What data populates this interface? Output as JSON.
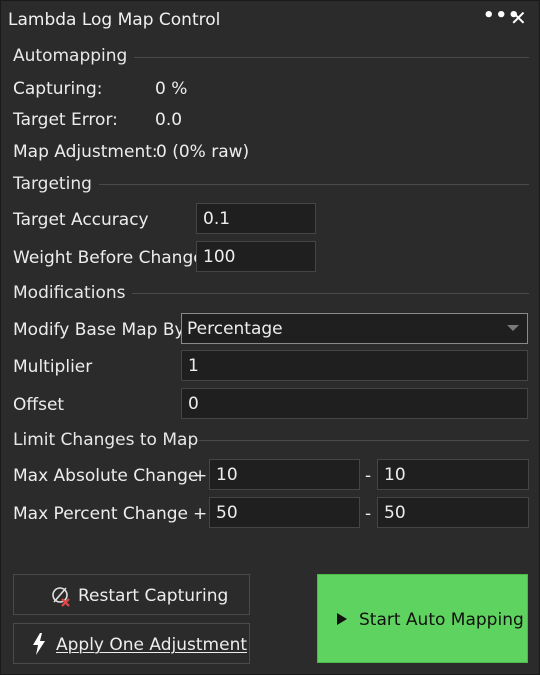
{
  "window": {
    "title": "Lambda Log Map Control",
    "more_icon": "more-horizontal-icon",
    "close_icon": "close-icon"
  },
  "automapping": {
    "header": "Automapping",
    "capturing_label": "Capturing:",
    "capturing_value": "0 %",
    "target_error_label": "Target Error:",
    "target_error_value": "0.0",
    "map_adjustment_label": "Map Adjustment:",
    "map_adjustment_value": "0 (0% raw)"
  },
  "targeting": {
    "header": "Targeting",
    "target_accuracy_label": "Target Accuracy",
    "target_accuracy_value": "0.1",
    "weight_label": "Weight Before Change",
    "weight_value": "100"
  },
  "modifications": {
    "header": "Modifications",
    "modify_label": "Modify Base Map By",
    "modify_value": "Percentage",
    "multiplier_label": "Multiplier",
    "multiplier_value": "1",
    "offset_label": "Offset",
    "offset_value": "0"
  },
  "limits": {
    "header": "Limit Changes to Map",
    "max_abs_label": "Max Absolute Change",
    "plus": "+",
    "minus": "-",
    "max_abs_plus": "10",
    "max_abs_minus": "10",
    "max_pct_label": "Max Percent Change",
    "max_pct_plus": "50",
    "max_pct_minus": "50"
  },
  "actions": {
    "restart_label": "Restart Capturing",
    "restart_icon": "restart-capture-icon",
    "apply_label": "Apply One Adjustment",
    "apply_icon": "lightning-icon",
    "start_label": "Start Auto Mapping",
    "start_icon": "play-icon",
    "start_color": "#5fd35f"
  }
}
